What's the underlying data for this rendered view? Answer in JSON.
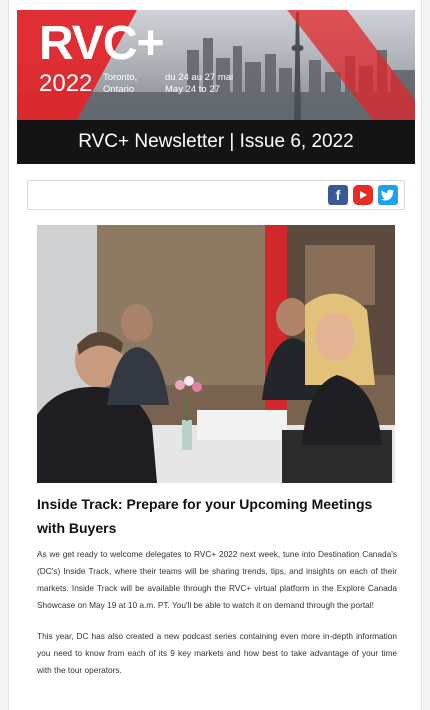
{
  "header": {
    "logo_text": "RVC+",
    "year": "2022",
    "city_line1": "Toronto,",
    "city_line2": "Ontario",
    "dates_line1": "du 24 au 27 mai",
    "dates_line2": "May 24 to 27",
    "accent_color": "#e0262b"
  },
  "newsletter": {
    "title": "RVC+ Newsletter | Issue 6, 2022"
  },
  "social": {
    "icons": [
      "facebook-icon",
      "youtube-icon",
      "twitter-icon"
    ],
    "colors": {
      "facebook": "#3b5998",
      "youtube": "#e52d27",
      "twitter": "#1da1f2"
    }
  },
  "article": {
    "headline": "Inside Track: Prepare for your Upcoming Meetings with Buyers",
    "paragraph1": "As we get ready to welcome delegates to RVC+ 2022 next week, tune into Destination Canada's (DC's) Inside Track, where their teams will be sharing trends, tips, and insights on each of their markets. Inside Track will be available through the RVC+ virtual platform in the Explore Canada Showcase on May 19 at 10 a.m. PT. You'll be able to watch it on demand through the portal!",
    "paragraph2": "This year, DC has also created a new podcast series containing even more in-depth information you need to know from each of its 9 key markets and how best to take advantage of your time with the tour operators."
  }
}
